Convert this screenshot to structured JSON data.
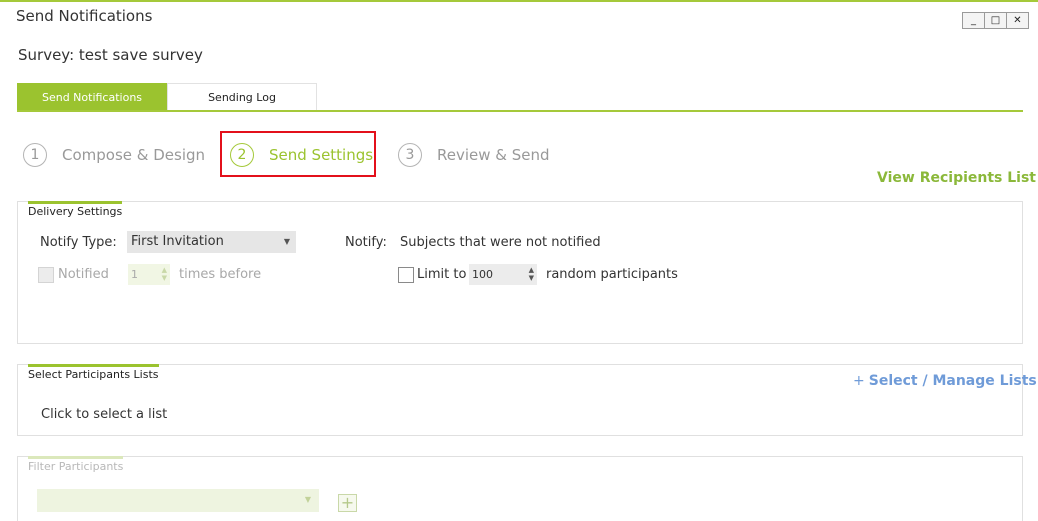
{
  "window": {
    "title": "Send Notifications",
    "controls": {
      "minimize": "_",
      "maximize": "□",
      "close": "✕"
    }
  },
  "survey_label": "Survey: test save survey",
  "tabs": [
    {
      "label": "Send Notifications",
      "active": true
    },
    {
      "label": "Sending Log",
      "active": false
    }
  ],
  "steps": [
    {
      "number": "1",
      "label": "Compose & Design",
      "active": false
    },
    {
      "number": "2",
      "label": "Send Settings",
      "active": true
    },
    {
      "number": "3",
      "label": "Review & Send",
      "active": false
    }
  ],
  "view_recipients_link": "View Recipients List",
  "delivery": {
    "title": "Delivery Settings",
    "notify_type_label": "Notify Type:",
    "notify_type_value": "First Invitation",
    "notify_label": "Notify:",
    "notify_value": "Subjects that were not notified",
    "notified_label": "Notified",
    "notified_count": "1",
    "times_before_label": "times before",
    "limit_label": "Limit to",
    "limit_value": "100",
    "random_label": "random participants"
  },
  "participants": {
    "title": "Select Participants Lists",
    "manage_link": "Select / Manage Lists",
    "manage_plus": "+",
    "placeholder": "Click to select a list"
  },
  "filter": {
    "title": "Filter Participants",
    "add_symbol": "+"
  },
  "colors": {
    "accent_green": "#9bc32f",
    "highlight_red": "#e3101b",
    "link_blue": "#6f9bd8"
  }
}
